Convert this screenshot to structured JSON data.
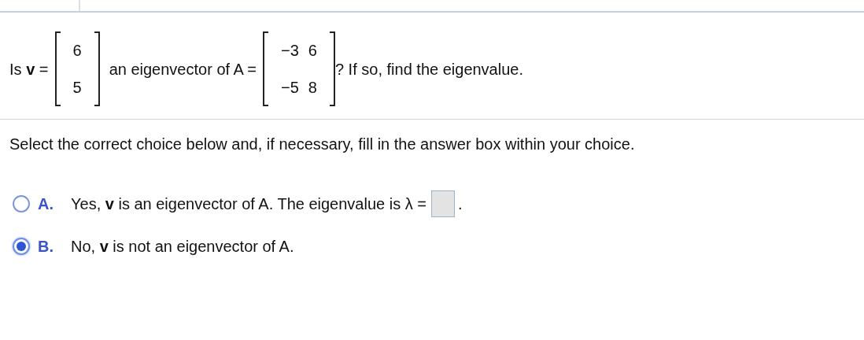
{
  "question": {
    "prefix": "Is **v** =",
    "vector": [
      "6",
      "5"
    ],
    "middle": "an eigenvector of A =",
    "matrix": [
      [
        "−3",
        "6"
      ],
      [
        "−5",
        "8"
      ]
    ],
    "suffix": "? If so, find the eigenvalue."
  },
  "instruction": "Select the correct choice below and, if necessary, fill in the answer box within your choice.",
  "choices": [
    {
      "letter": "A.",
      "text": "Yes, **v** is an eigenvector of A. The eigenvalue is λ =",
      "kind": "answer",
      "after": ".",
      "selected": false
    },
    {
      "letter": "B.",
      "text": "No, **v** is not an eigenvector of A.",
      "kind": "plain",
      "selected": true
    }
  ]
}
